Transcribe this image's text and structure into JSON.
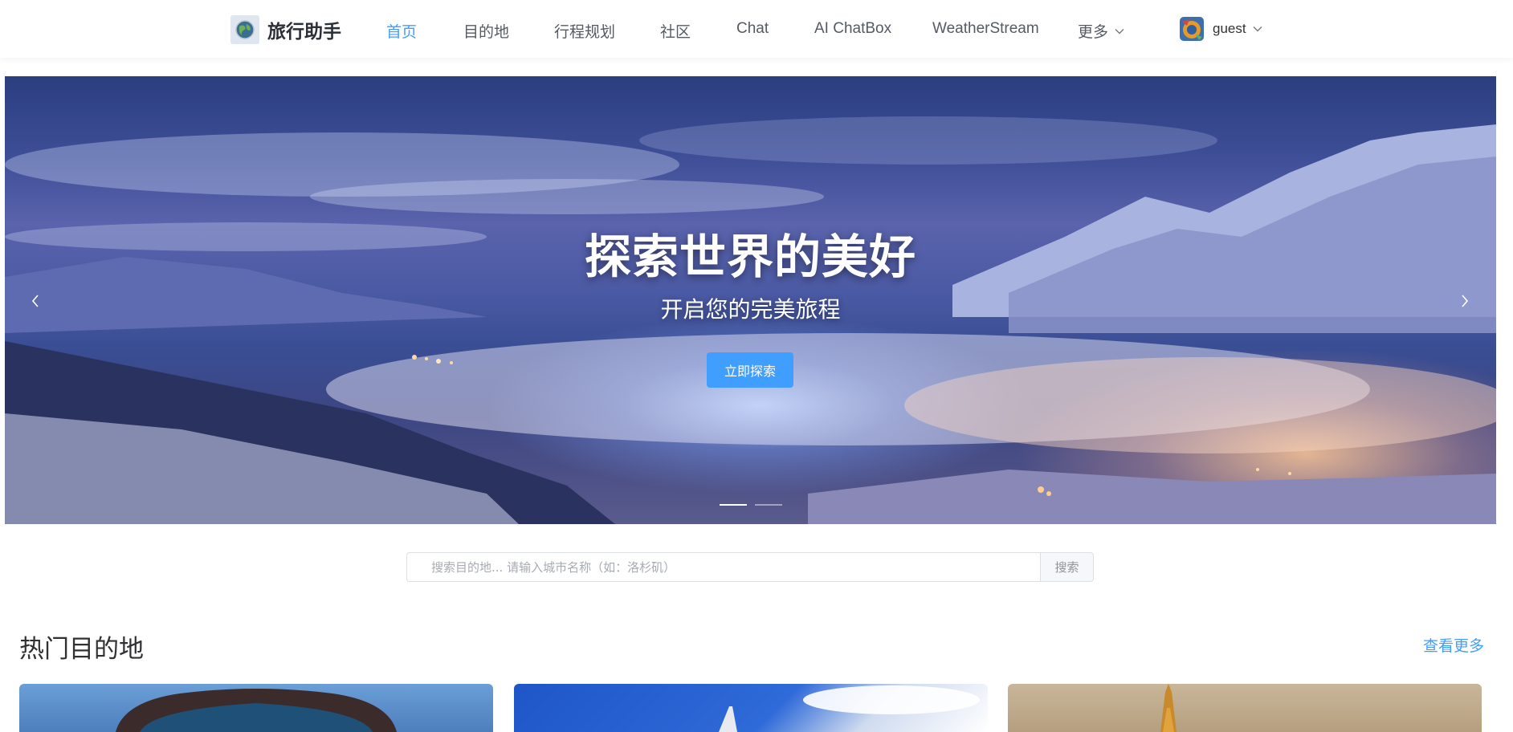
{
  "header": {
    "logo_text": "旅行助手",
    "nav": [
      {
        "label": "首页",
        "active": true
      },
      {
        "label": "目的地"
      },
      {
        "label": "行程规划"
      },
      {
        "label": "社区"
      },
      {
        "label": "Chat"
      },
      {
        "label": "AI ChatBox"
      },
      {
        "label": "WeatherStream"
      },
      {
        "label": "更多",
        "icon": "chevron-down-icon"
      }
    ],
    "user": {
      "name": "guest",
      "icon": "chevron-down-icon"
    }
  },
  "banner": {
    "title": "探索世界的美好",
    "subtitle": "开启您的完美旅程",
    "button": "立即探索",
    "slide_count": 2,
    "active_slide": 1
  },
  "search": {
    "placeholder": "搜索目的地... 请输入城市名称（如：洛杉矶）",
    "button": "搜索"
  },
  "popular": {
    "title": "热门目的地",
    "view_more": "查看更多"
  },
  "colors": {
    "accent": "#409eff",
    "text": "#303133",
    "nav_text": "#555a63"
  }
}
